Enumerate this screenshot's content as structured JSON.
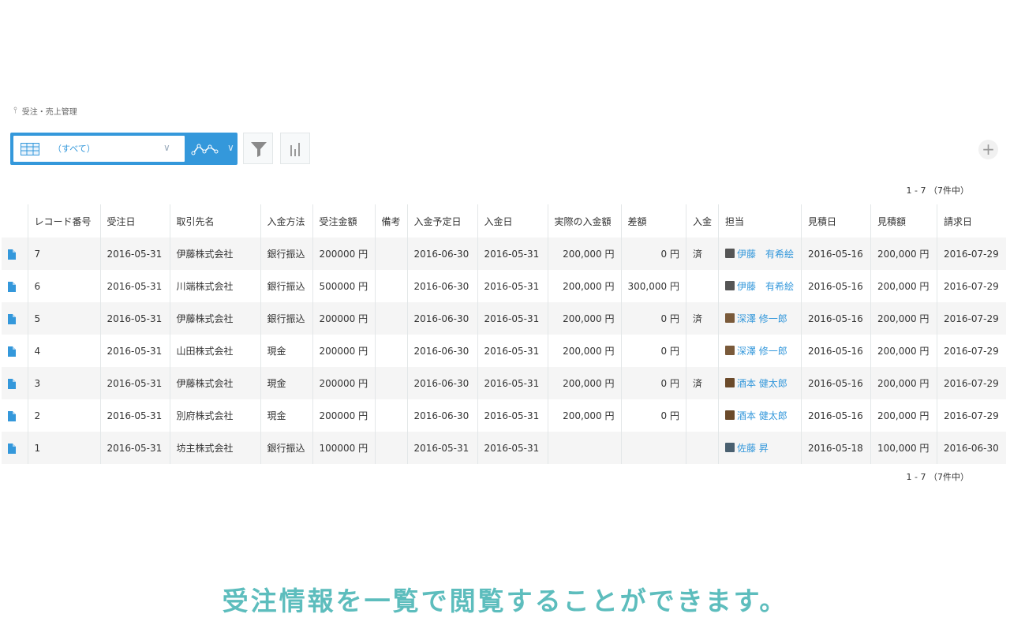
{
  "breadcrumb": {
    "app_name": "受注・売上管理"
  },
  "view": {
    "name": "（すべて）"
  },
  "pagination": {
    "top": "1 - 7 （7件中）",
    "bottom": "1 - 7 （7件中）"
  },
  "table": {
    "headers": {
      "record_no": "レコード番号",
      "order_date": "受注日",
      "client": "取引先名",
      "payment_method": "入金方法",
      "order_amount": "受注金額",
      "note": "備考",
      "payment_due": "入金予定日",
      "payment_date": "入金日",
      "actual_paid": "実際の入金額",
      "difference": "差額",
      "paid_flag": "入金",
      "owner": "担当",
      "estimate_date": "見積日",
      "estimate_amount": "見積額",
      "invoice_date": "請求日"
    },
    "rows": [
      {
        "record_no": "7",
        "order_date": "2016-05-31",
        "client": "伊藤株式会社",
        "payment_method": "銀行振込",
        "order_amount": "200000 円",
        "note": "",
        "payment_due": "2016-06-30",
        "payment_date": "2016-05-31",
        "actual_paid": "200,000 円",
        "difference": "0 円",
        "paid_flag": "済",
        "owner": "伊藤　有希絵",
        "estimate_date": "2016-05-16",
        "estimate_amount": "200,000 円",
        "invoice_date": "2016-07-29"
      },
      {
        "record_no": "6",
        "order_date": "2016-05-31",
        "client": "川端株式会社",
        "payment_method": "銀行振込",
        "order_amount": "500000 円",
        "note": "",
        "payment_due": "2016-06-30",
        "payment_date": "2016-05-31",
        "actual_paid": "200,000 円",
        "difference": "300,000 円",
        "paid_flag": "",
        "owner": "伊藤　有希絵",
        "estimate_date": "2016-05-16",
        "estimate_amount": "200,000 円",
        "invoice_date": "2016-07-29"
      },
      {
        "record_no": "5",
        "order_date": "2016-05-31",
        "client": "伊藤株式会社",
        "payment_method": "銀行振込",
        "order_amount": "200000 円",
        "note": "",
        "payment_due": "2016-06-30",
        "payment_date": "2016-05-31",
        "actual_paid": "200,000 円",
        "difference": "0 円",
        "paid_flag": "済",
        "owner": "深澤 修一郎",
        "estimate_date": "2016-05-16",
        "estimate_amount": "200,000 円",
        "invoice_date": "2016-07-29"
      },
      {
        "record_no": "4",
        "order_date": "2016-05-31",
        "client": "山田株式会社",
        "payment_method": "現金",
        "order_amount": "200000 円",
        "note": "",
        "payment_due": "2016-06-30",
        "payment_date": "2016-05-31",
        "actual_paid": "200,000 円",
        "difference": "0 円",
        "paid_flag": "",
        "owner": "深澤 修一郎",
        "estimate_date": "2016-05-16",
        "estimate_amount": "200,000 円",
        "invoice_date": "2016-07-29"
      },
      {
        "record_no": "3",
        "order_date": "2016-05-31",
        "client": "伊藤株式会社",
        "payment_method": "現金",
        "order_amount": "200000 円",
        "note": "",
        "payment_due": "2016-06-30",
        "payment_date": "2016-05-31",
        "actual_paid": "200,000 円",
        "difference": "0 円",
        "paid_flag": "済",
        "owner": "酒本 健太郎",
        "estimate_date": "2016-05-16",
        "estimate_amount": "200,000 円",
        "invoice_date": "2016-07-29"
      },
      {
        "record_no": "2",
        "order_date": "2016-05-31",
        "client": "別府株式会社",
        "payment_method": "現金",
        "order_amount": "200000 円",
        "note": "",
        "payment_due": "2016-06-30",
        "payment_date": "2016-05-31",
        "actual_paid": "200,000 円",
        "difference": "0 円",
        "paid_flag": "",
        "owner": "酒本 健太郎",
        "estimate_date": "2016-05-16",
        "estimate_amount": "200,000 円",
        "invoice_date": "2016-07-29"
      },
      {
        "record_no": "1",
        "order_date": "2016-05-31",
        "client": "坊主株式会社",
        "payment_method": "銀行振込",
        "order_amount": "100000 円",
        "note": "",
        "payment_due": "2016-05-31",
        "payment_date": "2016-05-31",
        "actual_paid": "",
        "difference": "",
        "paid_flag": "",
        "owner": "佐藤 昇",
        "estimate_date": "2016-05-18",
        "estimate_amount": "100,000 円",
        "invoice_date": "2016-06-30"
      }
    ]
  },
  "caption": "受注情報を一覧で閲覧することができます。",
  "icons": {
    "pin": "pin-icon",
    "table": "table-view-icon",
    "graph": "graph-icon",
    "filter": "filter-icon",
    "chart": "bar-chart-icon",
    "add": "plus-icon",
    "record": "document-icon"
  },
  "colors": {
    "accent": "#3498db",
    "caption": "#5dbdbd",
    "row_alt": "#f5f5f5"
  }
}
